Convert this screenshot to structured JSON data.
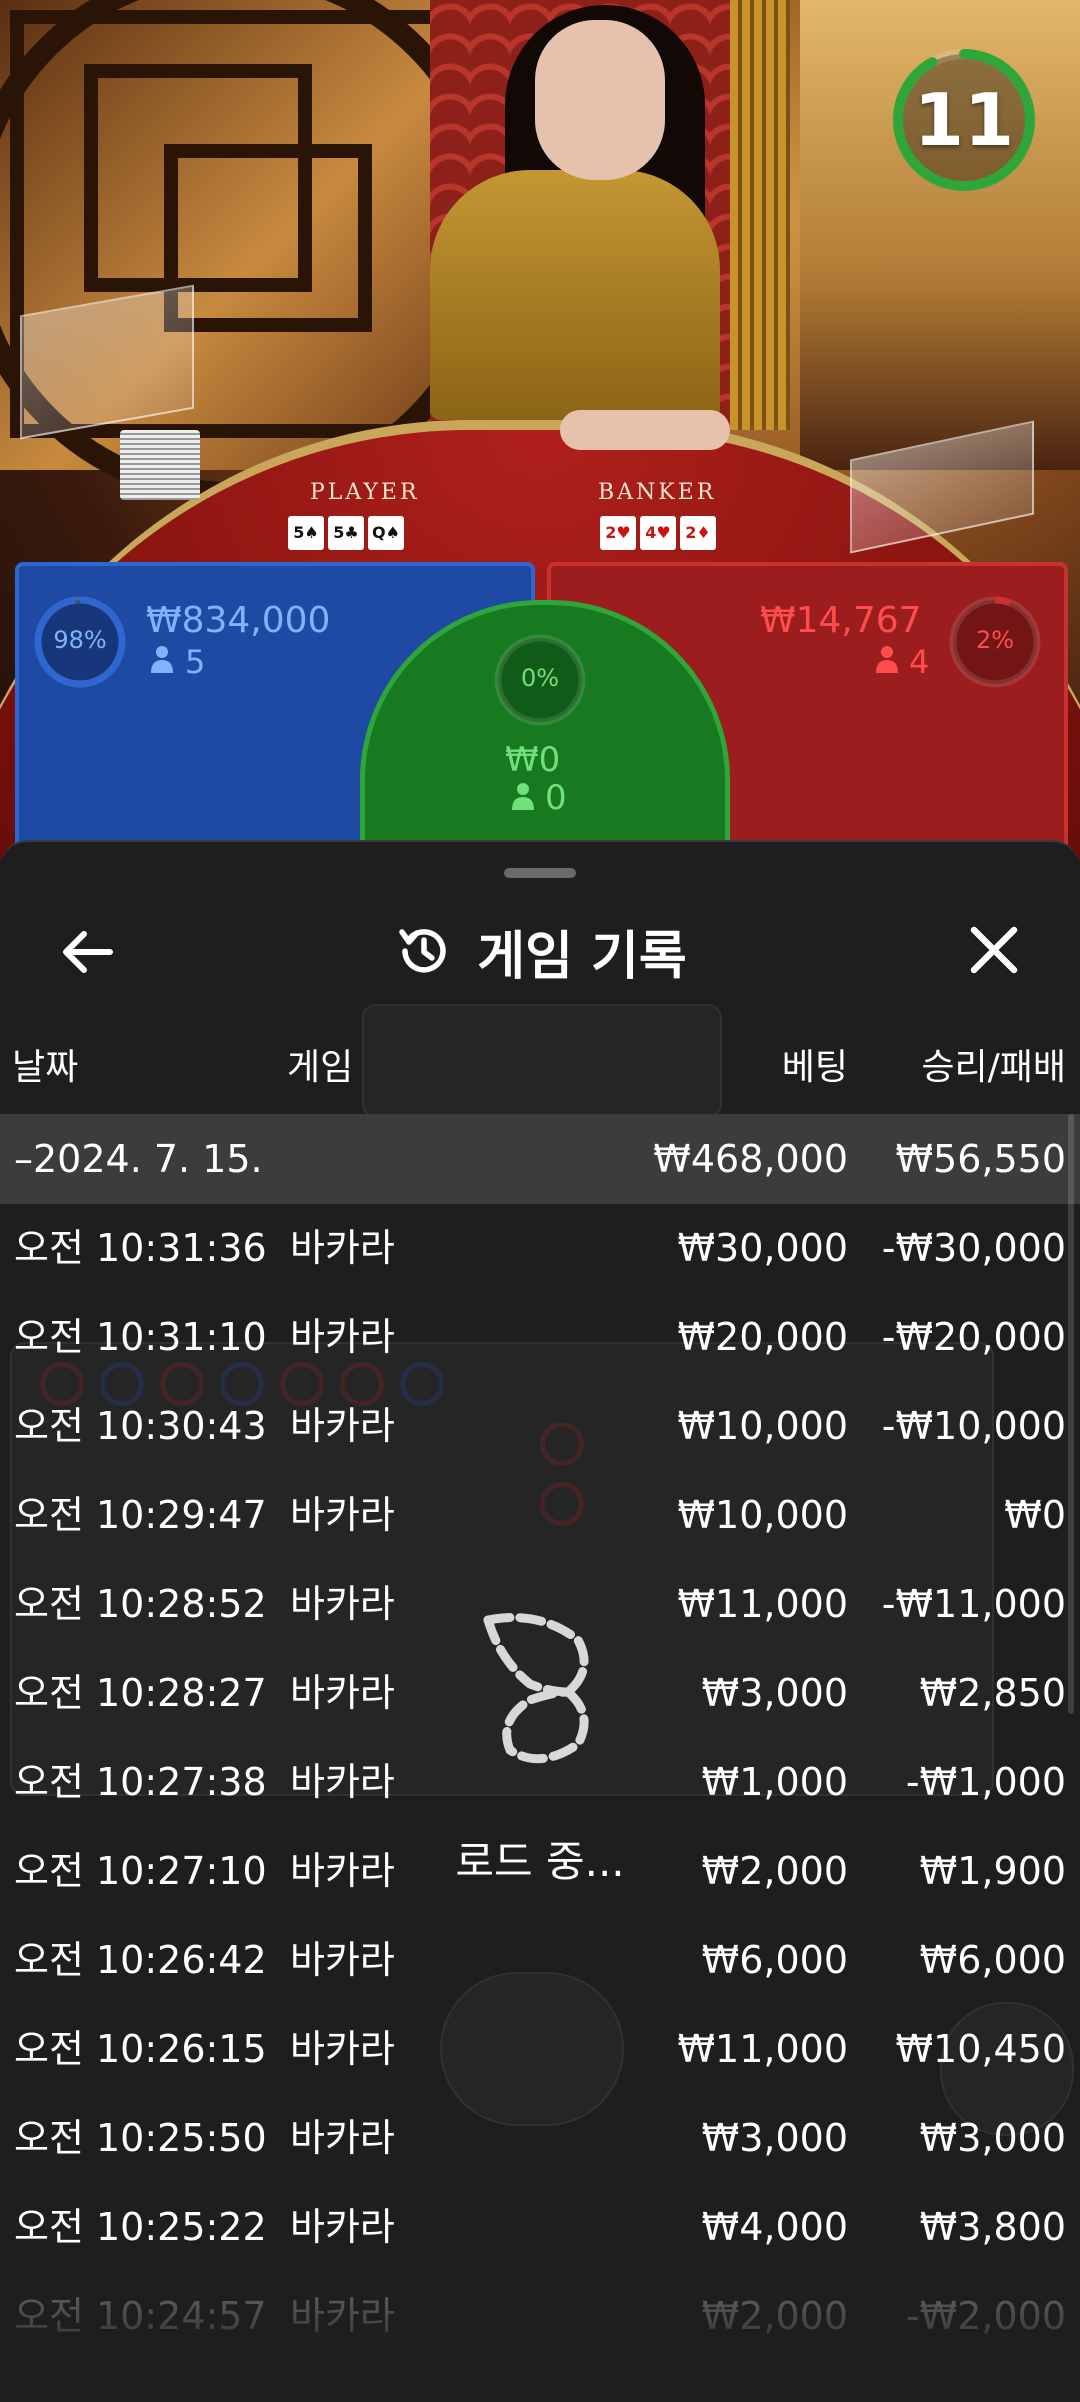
{
  "video": {
    "player_label": "PLAYER",
    "banker_label": "BANKER",
    "player_cards": [
      "5♠",
      "5♣",
      "Q♠"
    ],
    "banker_cards": [
      "2♥",
      "4♥",
      "2♦"
    ]
  },
  "timer": {
    "value": "11",
    "progress": 0.92,
    "color": "#2ea63a"
  },
  "bets": {
    "player": {
      "percent": "98%",
      "percent_value": 0.98,
      "amount": "₩834,000",
      "count": "5",
      "color": "#2f66cf"
    },
    "tie": {
      "percent": "0%",
      "amount": "₩0",
      "count": "0",
      "color": "#2ea63a"
    },
    "banker": {
      "percent": "2%",
      "percent_value": 0.02,
      "amount": "₩14,767",
      "count": "4",
      "color": "#c93131"
    }
  },
  "sheet": {
    "title": "게임 기록",
    "back_icon": "arrow-left-icon",
    "history_icon": "history-icon",
    "close_icon": "close-icon",
    "columns": {
      "date": "날짜",
      "game": "게임",
      "bet": "베팅",
      "result": "승리/패배"
    },
    "date_group": {
      "date": "–2024. 7. 15.",
      "bet": "₩468,000",
      "result": "₩56,550"
    },
    "rows": [
      {
        "time": "오전 10:31:36",
        "game": "바카라",
        "bet": "₩30,000",
        "result": "-₩30,000"
      },
      {
        "time": "오전 10:31:10",
        "game": "바카라",
        "bet": "₩20,000",
        "result": "-₩20,000"
      },
      {
        "time": "오전 10:30:43",
        "game": "바카라",
        "bet": "₩10,000",
        "result": "-₩10,000"
      },
      {
        "time": "오전 10:29:47",
        "game": "바카라",
        "bet": "₩10,000",
        "result": "₩0"
      },
      {
        "time": "오전 10:28:52",
        "game": "바카라",
        "bet": "₩11,000",
        "result": "-₩11,000"
      },
      {
        "time": "오전 10:28:27",
        "game": "바카라",
        "bet": "₩3,000",
        "result": "₩2,850"
      },
      {
        "time": "오전 10:27:38",
        "game": "바카라",
        "bet": "₩1,000",
        "result": "-₩1,000"
      },
      {
        "time": "오전 10:27:10",
        "game": "바카라",
        "bet": "₩2,000",
        "result": "₩1,900"
      },
      {
        "time": "오전 10:26:42",
        "game": "바카라",
        "bet": "₩6,000",
        "result": "₩6,000"
      },
      {
        "time": "오전 10:26:15",
        "game": "바카라",
        "bet": "₩11,000",
        "result": "₩10,450"
      },
      {
        "time": "오전 10:25:50",
        "game": "바카라",
        "bet": "₩3,000",
        "result": "₩3,000"
      },
      {
        "time": "오전 10:25:22",
        "game": "바카라",
        "bet": "₩4,000",
        "result": "₩3,800"
      },
      {
        "time": "오전 10:24:57",
        "game": "바카라",
        "bet": "₩2,000",
        "result": "-₩2,000"
      }
    ],
    "loading_text": "로드 중..."
  }
}
